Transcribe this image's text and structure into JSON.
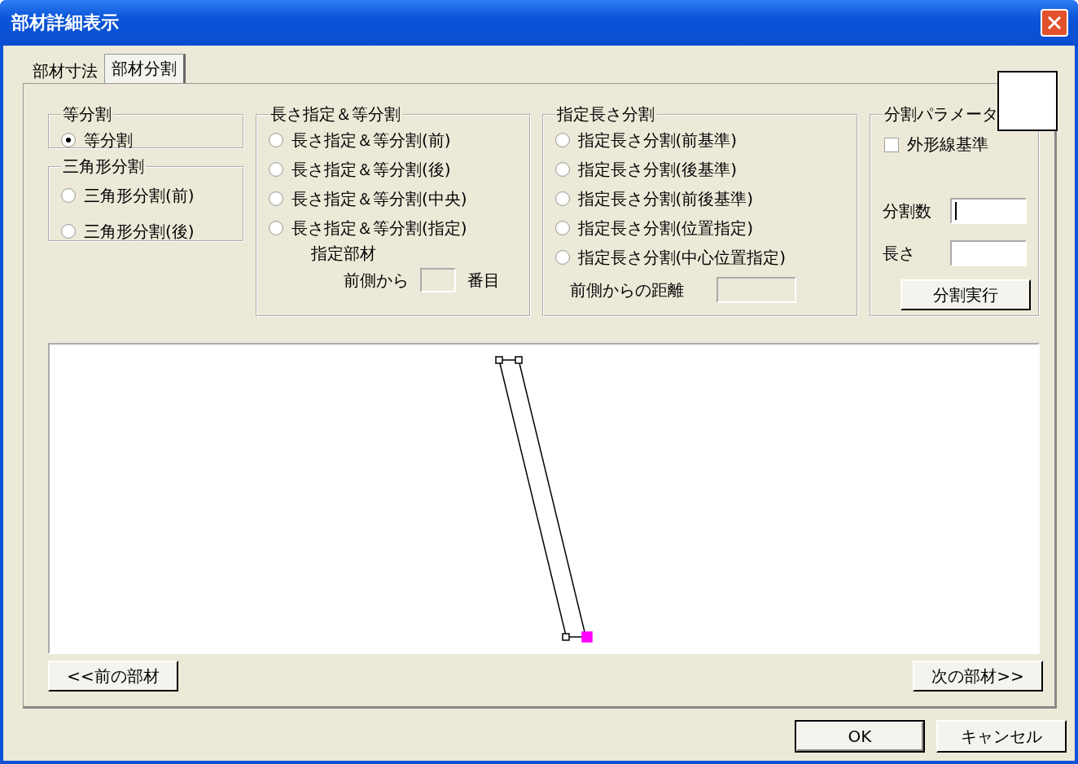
{
  "window": {
    "title": "部材詳細表示"
  },
  "tabs": [
    {
      "label": "部材寸法",
      "selected": false
    },
    {
      "label": "部材分割",
      "selected": true
    }
  ],
  "radio_groups": [
    {
      "title": "等分割",
      "options": [
        {
          "label": "等分割",
          "selected": true
        }
      ]
    },
    {
      "title": "三角形分割",
      "options": [
        {
          "label": "三角形分割(前)",
          "selected": false
        },
        {
          "label": "三角形分割(後)",
          "selected": false
        }
      ]
    },
    {
      "title": "長さ指定＆等分割",
      "options": [
        {
          "label": "長さ指定＆等分割(前)",
          "selected": false
        },
        {
          "label": "長さ指定＆等分割(後)",
          "selected": false
        },
        {
          "label": "長さ指定＆等分割(中央)",
          "selected": false
        },
        {
          "label": "長さ指定＆等分割(指定)",
          "selected": false
        }
      ],
      "extra": {
        "kind": "member",
        "label": "指定部材",
        "prefix": "前側から",
        "suffix": "番目"
      }
    },
    {
      "title": "指定長さ分割",
      "options": [
        {
          "label": "指定長さ分割(前基準)",
          "selected": false
        },
        {
          "label": "指定長さ分割(後基準)",
          "selected": false
        },
        {
          "label": "指定長さ分割(前後基準)",
          "selected": false
        },
        {
          "label": "指定長さ分割(位置指定)",
          "selected": false
        },
        {
          "label": "指定長さ分割(中心位置指定)",
          "selected": false
        }
      ],
      "extra": {
        "kind": "distance",
        "label": "前側からの距離",
        "disabled": true
      }
    }
  ],
  "parameters": {
    "title": "分割パラメータ",
    "checkbox": {
      "label": "外形線基準",
      "checked": false
    },
    "fields": [
      {
        "label": "分割数",
        "focused": true
      },
      {
        "label": "長さ",
        "focused": false
      }
    ],
    "button": "分割実行"
  },
  "navigation": {
    "previous": "<<前の部材",
    "next": "次の部材>>"
  },
  "buttons": [
    {
      "label": "OK",
      "default": true
    },
    {
      "label": "キャンセル",
      "default": false
    }
  ]
}
